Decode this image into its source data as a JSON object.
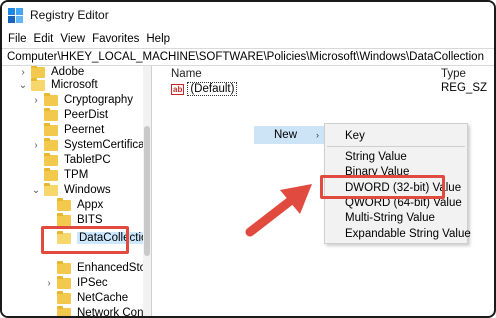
{
  "window": {
    "title": "Registry Editor",
    "icon": "registry-editor-icon"
  },
  "menu": [
    "File",
    "Edit",
    "View",
    "Favorites",
    "Help"
  ],
  "address": "Computer\\HKEY_LOCAL_MACHINE\\SOFTWARE\\Policies\\Microsoft\\Windows\\DataCollection",
  "tree": [
    {
      "label": "Adobe",
      "expander": "›"
    },
    {
      "label": "Microsoft",
      "expander": "⌄"
    },
    {
      "label": "Cryptography",
      "expander": "›"
    },
    {
      "label": "PeerDist",
      "expander": ""
    },
    {
      "label": "Peernet",
      "expander": ""
    },
    {
      "label": "SystemCertificates",
      "expander": "›"
    },
    {
      "label": "TabletPC",
      "expander": ""
    },
    {
      "label": "TPM",
      "expander": ""
    },
    {
      "label": "Windows",
      "expander": "⌄"
    },
    {
      "label": "Appx",
      "expander": ""
    },
    {
      "label": "BITS",
      "expander": ""
    },
    {
      "label": "DataCollection",
      "expander": ""
    },
    {
      "label": "EnhancedStorageDev",
      "expander": ""
    },
    {
      "label": "IPSec",
      "expander": "›"
    },
    {
      "label": "NetCache",
      "expander": ""
    },
    {
      "label": "Network Connection",
      "expander": ""
    }
  ],
  "columns": {
    "name": "Name",
    "type": "Type"
  },
  "values": [
    {
      "icon": "ab",
      "name": "(Default)",
      "type": "REG_SZ"
    }
  ],
  "context_menu": {
    "new_label": "New",
    "new_arrow": "›",
    "submenu": [
      "Key",
      "String Value",
      "Binary Value",
      "DWORD (32-bit) Value",
      "QWORD (64-bit) Value",
      "Multi-String Value",
      "Expandable String Value"
    ]
  },
  "colors": {
    "highlight_box": "#e04a3f",
    "selection": "#cde4f7",
    "folder": "#f3c94d"
  }
}
